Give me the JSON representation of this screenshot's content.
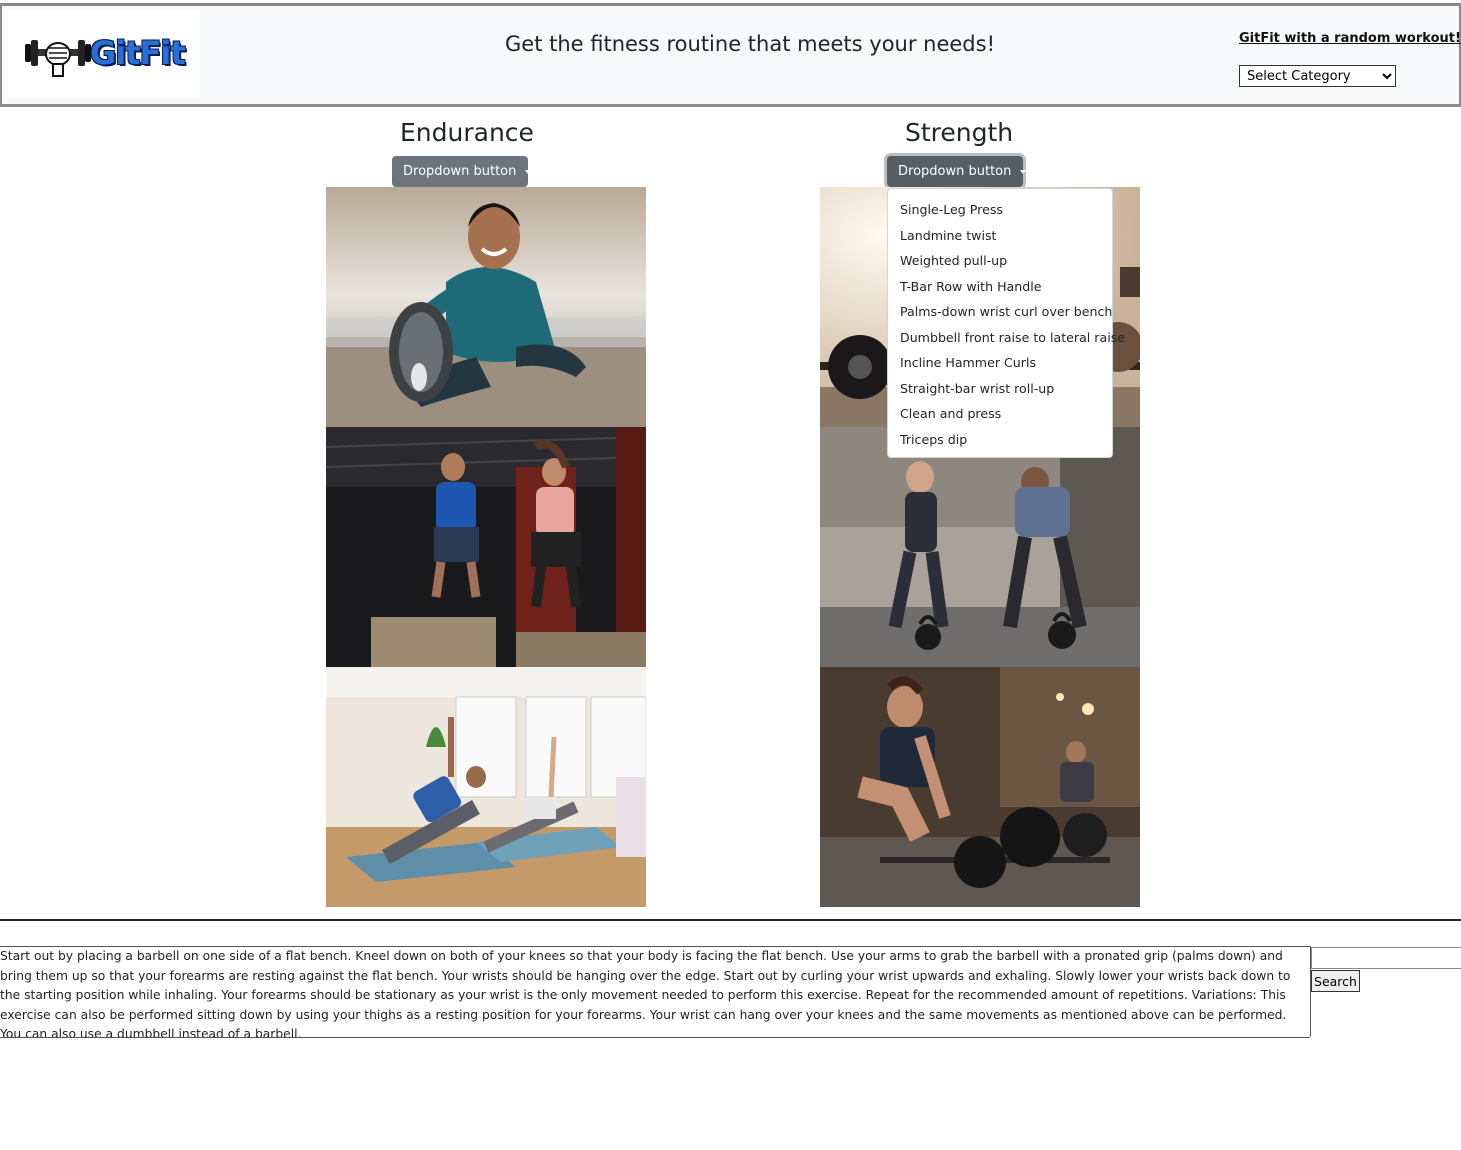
{
  "header": {
    "logo_text": "GitFit",
    "tagline": "Get the fitness routine that meets your needs!",
    "random_link": "GitFit with a random workout!",
    "category_select": {
      "selected": "Select Category"
    }
  },
  "columns": [
    {
      "title": "Endurance",
      "button_label": "Dropdown button",
      "photos": [
        "stretching-man-photo",
        "box-jump-photo",
        "yoga-class-photo"
      ]
    },
    {
      "title": "Strength",
      "button_label": "Dropdown button",
      "photos": [
        "barbell-photo",
        "kettlebell-photo",
        "deadlift-photo"
      ]
    }
  ],
  "strength_menu": {
    "items": [
      "Single-Leg Press",
      "Landmine twist",
      "Weighted pull-up",
      "T-Bar Row with Handle",
      "Palms-down wrist curl over bench",
      "Dumbbell front raise to lateral raise",
      "Incline Hammer Curls",
      "Straight-bar wrist roll-up",
      "Clean and press",
      "Triceps dip"
    ]
  },
  "exercise": {
    "description": "Start out by placing a barbell on one side of a flat bench. Kneel down on both of your knees so that your body is facing the flat bench. Use your arms to grab the barbell with a pronated grip (palms down) and bring them up so that your forearms are resting against the flat bench. Your wrists should be hanging over the edge. Start out by curling your wrist upwards and exhaling. Slowly lower your wrists back down to the starting position while inhaling. Your forearms should be stationary as your wrist is the only movement needed to perform this exercise. Repeat for the recommended amount of repetitions. Variations: This exercise can also be performed sitting down by using your thighs as a resting position for your forearms. Your wrist can hang over your knees and the same movements as mentioned above can be performed. You can also use a dumbbell instead of a barbell."
  },
  "search": {
    "value": "",
    "button_label": "Search"
  },
  "colors": {
    "button": "#6c757d",
    "logo_blue": "#2a6fd6",
    "header_bg": "#f8f9fa"
  }
}
